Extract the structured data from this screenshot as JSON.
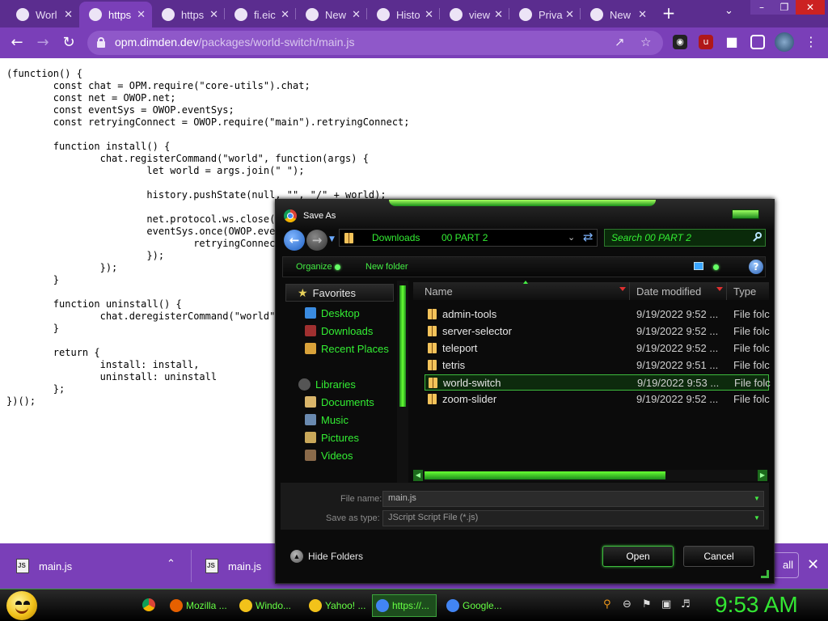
{
  "browser": {
    "tabs": [
      {
        "label": "Worl",
        "icon": "chrome-icon"
      },
      {
        "label": "https",
        "icon": "chrome-icon"
      },
      {
        "label": "https",
        "icon": "chrome-icon"
      },
      {
        "label": "fi.eic",
        "icon": "google-icon"
      },
      {
        "label": "New",
        "icon": "chrome-icon"
      },
      {
        "label": "Histo",
        "icon": "history-icon"
      },
      {
        "label": "view",
        "icon": "chrome-icon"
      },
      {
        "label": "Privacy e",
        "icon": "chrome-icon"
      },
      {
        "label": "New",
        "icon": "chrome-icon"
      }
    ],
    "url_host": "opm.dimden.dev",
    "url_path": "/packages/world-switch/main.js",
    "accent": "#7a3fb8",
    "tabstrip_color": "#5b2d8f"
  },
  "code": "(function() {\n\tconst chat = OPM.require(\"core-utils\").chat;\n\tconst net = OWOP.net;\n\tconst eventSys = OWOP.eventSys;\n\tconst retryingConnect = OWOP.require(\"main\").retryingConnect;\n\n\tfunction install() {\n\t\tchat.registerCommand(\"world\", function(args) {\n\t\t\tlet world = args.join(\" \");\n\n\t\t\thistory.pushState(null, \"\", \"/\" + world);\n\n\t\t\tnet.protocol.ws.close(\n\t\t\teventSys.once(OWOP.eve\n\t\t\t\tretryingConnec\n\t\t\t});\n\t\t});\n\t}\n\n\tfunction uninstall() {\n\t\tchat.deregisterCommand(\"world\"\n\t}\n\n\treturn {\n\t\tinstall: install,\n\t\tuninstall: uninstall\n\t};\n})();",
  "downloads": {
    "items": [
      {
        "name": "main.js"
      },
      {
        "name": "main.js"
      }
    ],
    "show_all": "all"
  },
  "dialog": {
    "title": "Save As",
    "breadcrumbs": [
      "Downloads",
      "00 PART 2"
    ],
    "search_placeholder": "Search 00 PART 2",
    "organize": "Organize",
    "new_folder": "New folder",
    "nav": {
      "favorites": "Favorites",
      "fav_items": [
        {
          "label": "Desktop",
          "icon": "desktop-icon",
          "color": "#3a8be0"
        },
        {
          "label": "Downloads",
          "icon": "downloads-icon",
          "color": "#a03030"
        },
        {
          "label": "Recent Places",
          "icon": "recent-places-icon",
          "color": "#d9a23a"
        }
      ],
      "libraries": "Libraries",
      "lib_items": [
        {
          "label": "Documents",
          "icon": "documents-icon",
          "color": "#d9b56a"
        },
        {
          "label": "Music",
          "icon": "music-icon",
          "color": "#6a8ab0"
        },
        {
          "label": "Pictures",
          "icon": "pictures-icon",
          "color": "#c9a85a"
        },
        {
          "label": "Videos",
          "icon": "videos-icon",
          "color": "#8a6a4a"
        }
      ]
    },
    "columns": {
      "name": "Name",
      "date": "Date modified",
      "type": "Type"
    },
    "files": [
      {
        "name": "admin-tools",
        "date": "9/19/2022 9:52 ...",
        "type": "File folc"
      },
      {
        "name": "server-selector",
        "date": "9/19/2022 9:52 ...",
        "type": "File folc"
      },
      {
        "name": "teleport",
        "date": "9/19/2022 9:52 ...",
        "type": "File folc"
      },
      {
        "name": "tetris",
        "date": "9/19/2022 9:51 ...",
        "type": "File folc"
      },
      {
        "name": "world-switch",
        "date": "9/19/2022 9:53 ...",
        "type": "File folc"
      },
      {
        "name": "zoom-slider",
        "date": "9/19/2022 9:52 ...",
        "type": "File folc"
      }
    ],
    "file_name_label": "File name:",
    "file_name_value": "main.js",
    "save_type_label": "Save as type:",
    "save_type_value": "JScript Script File (*.js)",
    "hide_folders": "Hide Folders",
    "open_label": "Open",
    "cancel_label": "Cancel",
    "theme_green": "#33ee33"
  },
  "taskbar": {
    "tasks": [
      {
        "label": "Mozilla ...",
        "color": "#e66000"
      },
      {
        "label": "Windo...",
        "color": "#f2c21a"
      },
      {
        "label": "Yahoo! ...",
        "color": "#f2c21a"
      },
      {
        "label": "https://...",
        "color": "#4285f4"
      },
      {
        "label": "Google...",
        "color": "#4285f4"
      }
    ],
    "clock": "9:53 AM"
  }
}
